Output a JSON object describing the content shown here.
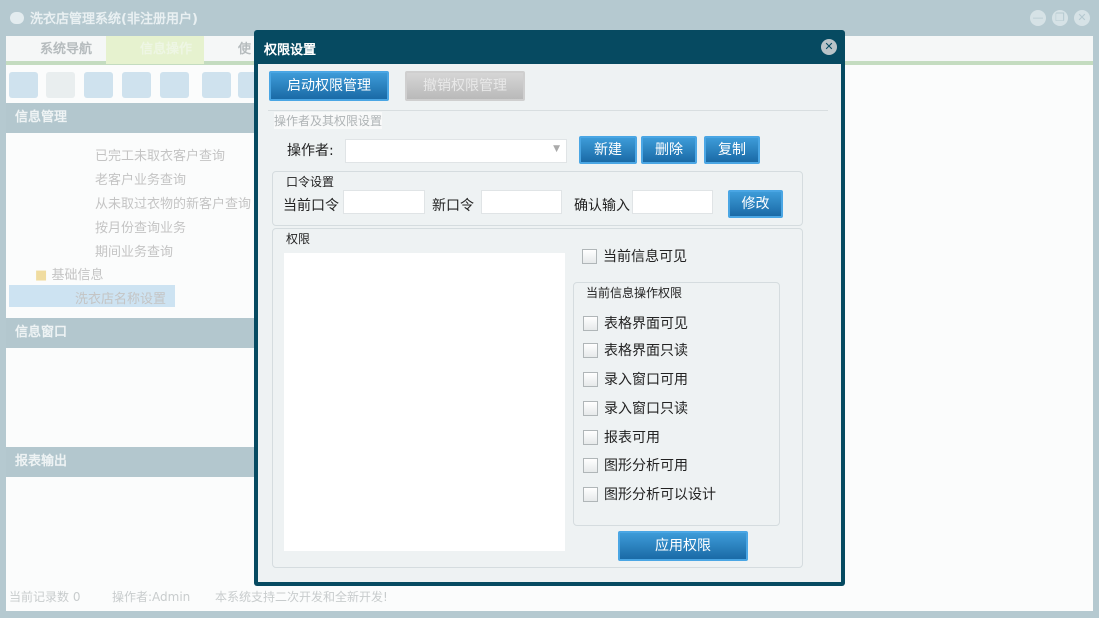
{
  "app": {
    "title": "洗衣店管理系统(非注册用户)"
  },
  "tabs": [
    {
      "label": "系统导航"
    },
    {
      "label": "信息操作"
    },
    {
      "label": "使"
    }
  ],
  "panels": {
    "info_mgmt": "信息管理",
    "info_window": "信息窗口",
    "report_output": "报表输出"
  },
  "tree": {
    "items": [
      "已完工未取衣客户查询",
      "老客户业务查询",
      "从未取过衣物的新客户查询",
      "按月份查询业务",
      "期间业务查询"
    ],
    "folder": "基础信息",
    "selected": "洗衣店名称设置"
  },
  "status": {
    "records": "当前记录数 0",
    "operator": "操作者:Admin",
    "note": "本系统支持二次开发和全新开发!"
  },
  "dialog": {
    "title": "权限设置",
    "start_btn": "启动权限管理",
    "cancel_btn": "撤销权限管理",
    "group_operator": "操作者及其权限设置",
    "operator_label": "操作者:",
    "operator_value": "",
    "new_btn": "新建",
    "delete_btn": "删除",
    "copy_btn": "复制",
    "pwd_group": "口令设置",
    "cur_pwd": "当前口令",
    "new_pwd": "新口令",
    "confirm_pwd": "确认输入",
    "modify_btn": "修改",
    "perm_group": "权限",
    "visible_cb": "当前信息可见",
    "ops_group": "当前信息操作权限",
    "ops": [
      "表格界面可见",
      "表格界面只读",
      "录入窗口可用",
      "录入窗口只读",
      "报表可用",
      "图形分析可用",
      "图形分析可以设计"
    ],
    "apply_btn": "应用权限"
  }
}
